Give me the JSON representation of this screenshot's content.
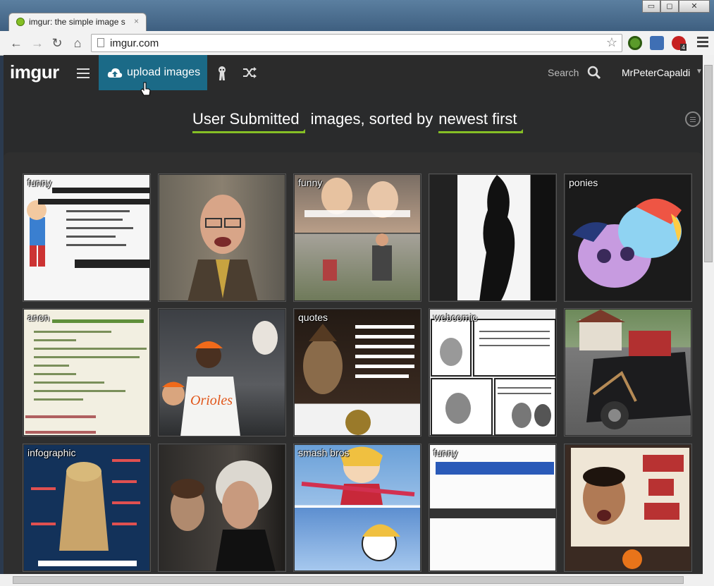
{
  "browser": {
    "tab_title": "imgur: the simple image s",
    "tab_close": "×",
    "url": "imgur.com",
    "window_buttons": [
      "▭",
      "◻",
      "✕"
    ],
    "extension_badge": "4"
  },
  "header": {
    "logo": "imgur",
    "upload_label": "upload images",
    "search_label": "Search",
    "username": "MrPeterCapaldi",
    "user_caret": "▼"
  },
  "sort": {
    "source": "User Submitted",
    "middle": "images, sorted by",
    "order": "newest first"
  },
  "colors": {
    "accent": "#85bf25",
    "upload_bg": "#1b6a87",
    "header_bg": "#2b2b2b"
  },
  "thumbnails": [
    {
      "tag": "funny"
    },
    {
      "tag": ""
    },
    {
      "tag": "funny"
    },
    {
      "tag": ""
    },
    {
      "tag": "ponies"
    },
    {
      "tag": "anon"
    },
    {
      "tag": ""
    },
    {
      "tag": "quotes"
    },
    {
      "tag": "webcomic"
    },
    {
      "tag": ""
    },
    {
      "tag": "infographic"
    },
    {
      "tag": ""
    },
    {
      "tag": "smash bros"
    },
    {
      "tag": "funny"
    },
    {
      "tag": ""
    }
  ]
}
